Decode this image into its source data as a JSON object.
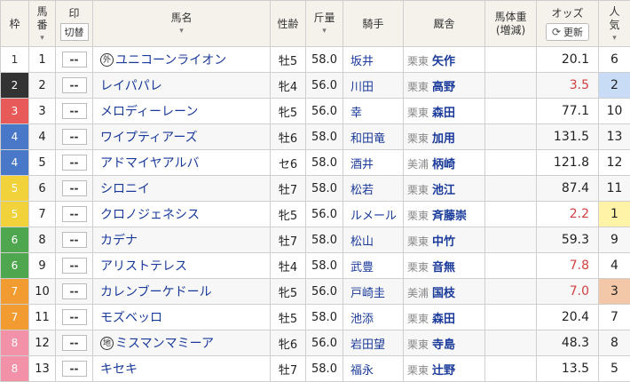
{
  "headers": {
    "waku": "枠",
    "umaban_top": "馬",
    "umaban_bottom": "番",
    "mark": "印",
    "mark_toggle": "切替",
    "horse": "馬名",
    "sexage": "性齢",
    "weight": "斤量",
    "jockey": "騎手",
    "stable": "厩舎",
    "bodyweight": "馬体重",
    "bodyweight_sub": "(増減)",
    "odds": "オッズ",
    "odds_refresh": "更新",
    "popularity_top": "人",
    "popularity_bottom": "気"
  },
  "colors": {
    "frame1": "#ffffff",
    "frame2": "#333333",
    "frame3": "#e85a5a",
    "frame4": "#4a78c8",
    "frame5": "#f1d23a",
    "frame6": "#4ea64e",
    "frame7": "#f29b30",
    "frame8": "#f291a8",
    "horse_link": "#1a3a9a",
    "favorite_odds": "#d04040"
  },
  "rows": [
    {
      "waku": "1",
      "umaban": "1",
      "mark": "--",
      "badge": "外",
      "horse": "ユニコーンライオン",
      "sexage": "牡5",
      "weight": "58.0",
      "jockey": "坂井",
      "loc": "栗東",
      "trainer": "矢作",
      "odds": "20.1",
      "pop": "6"
    },
    {
      "waku": "2",
      "umaban": "2",
      "mark": "--",
      "badge": "",
      "horse": "レイパパレ",
      "sexage": "牝4",
      "weight": "56.0",
      "jockey": "川田",
      "loc": "栗東",
      "trainer": "高野",
      "odds": "3.5",
      "pop": "2"
    },
    {
      "waku": "3",
      "umaban": "3",
      "mark": "--",
      "badge": "",
      "horse": "メロディーレーン",
      "sexage": "牝5",
      "weight": "56.0",
      "jockey": "幸",
      "loc": "栗東",
      "trainer": "森田",
      "odds": "77.1",
      "pop": "10"
    },
    {
      "waku": "4",
      "umaban": "4",
      "mark": "--",
      "badge": "",
      "horse": "ワイプティアーズ",
      "sexage": "牡6",
      "weight": "58.0",
      "jockey": "和田竜",
      "loc": "栗東",
      "trainer": "加用",
      "odds": "131.5",
      "pop": "13"
    },
    {
      "waku": "4",
      "umaban": "5",
      "mark": "--",
      "badge": "",
      "horse": "アドマイヤアルバ",
      "sexage": "セ6",
      "weight": "58.0",
      "jockey": "酒井",
      "loc": "美浦",
      "trainer": "柄崎",
      "odds": "121.8",
      "pop": "12"
    },
    {
      "waku": "5",
      "umaban": "6",
      "mark": "--",
      "badge": "",
      "horse": "シロニイ",
      "sexage": "牡7",
      "weight": "58.0",
      "jockey": "松若",
      "loc": "栗東",
      "trainer": "池江",
      "odds": "87.4",
      "pop": "11"
    },
    {
      "waku": "5",
      "umaban": "7",
      "mark": "--",
      "badge": "",
      "horse": "クロノジェネシス",
      "sexage": "牝5",
      "weight": "56.0",
      "jockey": "ルメール",
      "loc": "栗東",
      "trainer": "斉藤崇",
      "odds": "2.2",
      "pop": "1"
    },
    {
      "waku": "6",
      "umaban": "8",
      "mark": "--",
      "badge": "",
      "horse": "カデナ",
      "sexage": "牡7",
      "weight": "58.0",
      "jockey": "松山",
      "loc": "栗東",
      "trainer": "中竹",
      "odds": "59.3",
      "pop": "9"
    },
    {
      "waku": "6",
      "umaban": "9",
      "mark": "--",
      "badge": "",
      "horse": "アリストテレス",
      "sexage": "牡4",
      "weight": "58.0",
      "jockey": "武豊",
      "loc": "栗東",
      "trainer": "音無",
      "odds": "7.8",
      "pop": "4"
    },
    {
      "waku": "7",
      "umaban": "10",
      "mark": "--",
      "badge": "",
      "horse": "カレンブーケドール",
      "sexage": "牝5",
      "weight": "56.0",
      "jockey": "戸崎圭",
      "loc": "美浦",
      "trainer": "国枝",
      "odds": "7.0",
      "pop": "3"
    },
    {
      "waku": "7",
      "umaban": "11",
      "mark": "--",
      "badge": "",
      "horse": "モズベッロ",
      "sexage": "牡5",
      "weight": "58.0",
      "jockey": "池添",
      "loc": "栗東",
      "trainer": "森田",
      "odds": "20.4",
      "pop": "7"
    },
    {
      "waku": "8",
      "umaban": "12",
      "mark": "--",
      "badge": "地",
      "horse": "ミスマンマミーア",
      "sexage": "牝6",
      "weight": "56.0",
      "jockey": "岩田望",
      "loc": "栗東",
      "trainer": "寺島",
      "odds": "48.3",
      "pop": "8"
    },
    {
      "waku": "8",
      "umaban": "13",
      "mark": "--",
      "badge": "",
      "horse": "キセキ",
      "sexage": "牡7",
      "weight": "58.0",
      "jockey": "福永",
      "loc": "栗東",
      "trainer": "辻野",
      "odds": "13.5",
      "pop": "5"
    }
  ]
}
